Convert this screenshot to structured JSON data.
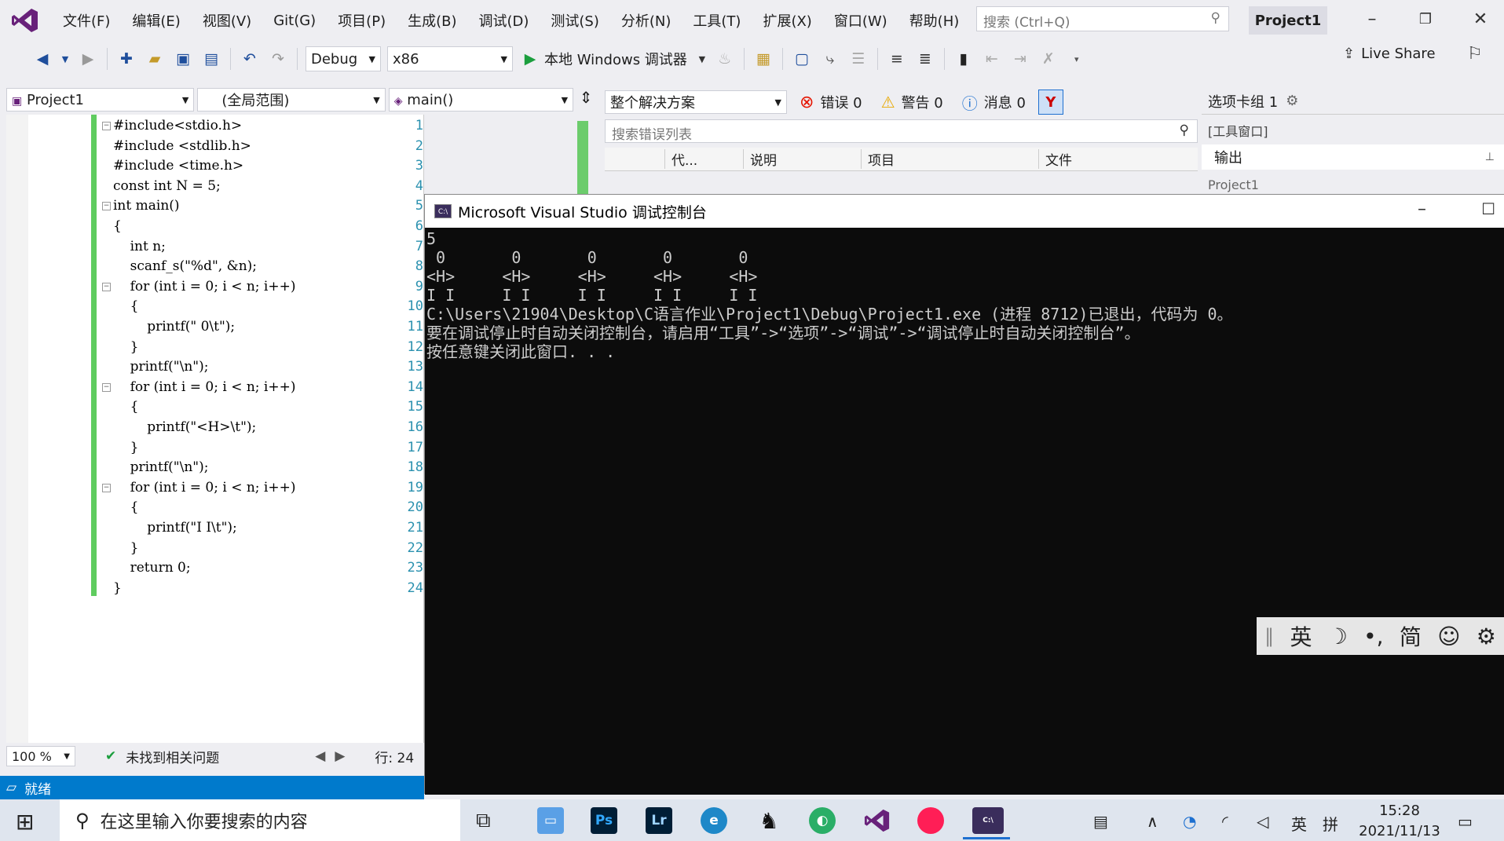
{
  "menu": {
    "items": [
      "文件(F)",
      "编辑(E)",
      "视图(V)",
      "Git(G)",
      "项目(P)",
      "生成(B)",
      "调试(D)",
      "测试(S)",
      "分析(N)",
      "工具(T)",
      "扩展(X)",
      "窗口(W)",
      "帮助(H)"
    ],
    "search_placeholder": "搜索 (Ctrl+Q)",
    "project_name": "Project1"
  },
  "toolbar": {
    "config": "Debug",
    "platform": "x86",
    "debugger": "本地 Windows 调试器",
    "live_share": "Live Share"
  },
  "editor": {
    "project_drop": "Project1",
    "scope_drop": "(全局范围)",
    "func_drop": "main()",
    "lines": [
      "#include<stdio.h>",
      "#include <stdlib.h>",
      "#include <time.h>",
      "const int N = 5;",
      "int main()",
      "{",
      "    int n;",
      "    scanf_s(\"%d\", &n);",
      "    for (int i = 0; i < n; i++)",
      "    {",
      "        printf(\" 0\\t\");",
      "    }",
      "    printf(\"\\n\");",
      "    for (int i = 0; i < n; i++)",
      "    {",
      "        printf(\"<H>\\t\");",
      "    }",
      "    printf(\"\\n\");",
      "    for (int i = 0; i < n; i++)",
      "    {",
      "        printf(\"I I\\t\");",
      "    }",
      "    return 0;",
      "}"
    ],
    "line_numbers": [
      "1",
      "2",
      "3",
      "4",
      "5",
      "6",
      "7",
      "8",
      "9",
      "10",
      "11",
      "12",
      "13",
      "14",
      "15",
      "16",
      "17",
      "18",
      "19",
      "20",
      "21",
      "22",
      "23",
      "24"
    ],
    "zoom": "100 %",
    "issues": "未找到相关问题",
    "row": "行: 24"
  },
  "errorlist": {
    "scope": "整个解决方案",
    "errors": "错误 0",
    "warnings": "警告 0",
    "messages": "消息 0",
    "search_placeholder": "搜索错误列表",
    "col_code": "代...",
    "col_desc": "说明",
    "col_project": "项目",
    "col_file": "文件"
  },
  "rightpanel": {
    "tab_group": "选项卡组 1",
    "tool_window": "[工具窗口]",
    "output": "输出",
    "project": "Project1"
  },
  "console": {
    "title": "Microsoft Visual Studio 调试控制台",
    "icon_text": "C:\\",
    "output": "5\n 0       0       0       0       0\n<H>     <H>     <H>     <H>     <H>\nI I     I I     I I     I I     I I\nC:\\Users\\21904\\Desktop\\C语言作业\\Project1\\Debug\\Project1.exe (进程 8712)已退出，代码为 0。\n要在调试停止时自动关闭控制台，请启用“工具”->“选项”->“调试”->“调试停止时自动关闭控制台”。\n按任意键关闭此窗口. . ."
  },
  "ime": {
    "lang": "英",
    "mode": "简"
  },
  "status": {
    "ready": "就绪"
  },
  "taskbar": {
    "search_placeholder": "在这里输入你要搜索的内容",
    "ps": "Ps",
    "lr": "Lr",
    "tray_lang": "英",
    "tray_ime": "拼",
    "time": "15:28",
    "date": "2021/11/13"
  },
  "colors": {
    "accent": "#007acc",
    "vs_purple": "#68217a",
    "console_bg": "#0c0c0c"
  }
}
